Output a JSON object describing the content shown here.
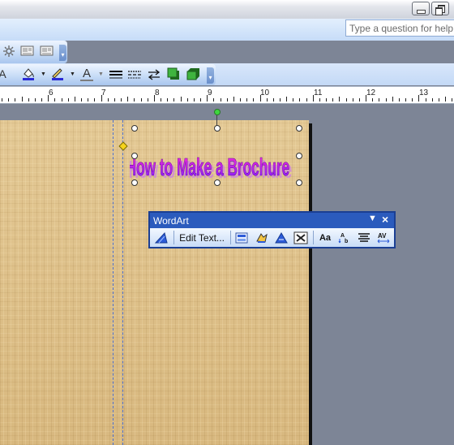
{
  "window": {
    "minimize_icon": "minimize-icon",
    "restore_icon": "restore-icon"
  },
  "help": {
    "placeholder": "Type a question for help"
  },
  "toolbar1": {
    "icons": [
      "hyphenation-icon",
      "picture-placeholder-icon",
      "picture-placeholder-icon",
      "toolbar-options-icon"
    ]
  },
  "toolbar2": {
    "icons": [
      "fill-color-icon",
      "line-color-icon",
      "font-color-icon",
      "line-style-icon",
      "dash-style-icon",
      "arrow-style-icon",
      "shadow-icon",
      "3d-icon",
      "toolbar-options-icon"
    ]
  },
  "ruler": {
    "numbers": [
      "6",
      "7",
      "8",
      "9",
      "10",
      "11",
      "12",
      "13"
    ]
  },
  "wordart": {
    "text": "How to Make a Brochure",
    "colors": {
      "fill_top": "#ff2bd1",
      "fill_bottom": "#7a1bff",
      "shadow": "#c86bff"
    }
  },
  "wordart_toolbar": {
    "title": "WordArt",
    "edit_text_label": "Edit Text...",
    "buttons": [
      "insert-wordart-icon",
      "wordart-gallery-icon",
      "format-wordart-icon",
      "wordart-shape-icon",
      "text-wrapping-icon",
      "same-letter-heights-icon",
      "vertical-text-icon",
      "alignment-icon",
      "character-spacing-icon"
    ]
  },
  "colors": {
    "page": "#dec08e",
    "workspace": "#7d8596",
    "toolbar_title": "#2b5bbd"
  }
}
